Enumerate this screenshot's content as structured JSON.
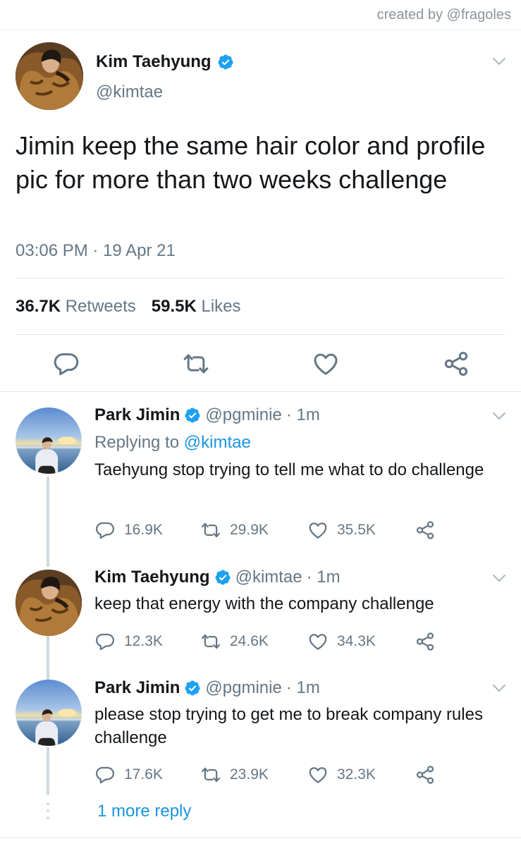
{
  "credit": "created by @fragoles",
  "colors": {
    "accent": "#1da1f2",
    "link": "#1b95e0",
    "muted": "#657786",
    "verified": "#1da1f2"
  },
  "main_tweet": {
    "name": "Kim Taehyung",
    "handle": "@kimtae",
    "verified": true,
    "text": "Jimin keep the same hair color and profile pic for more than two weeks challenge",
    "time": "03:06 PM · 19 Apr 21",
    "retweets_count": "36.7K",
    "retweets_label": "Retweets",
    "likes_count": "59.5K",
    "likes_label": "Likes",
    "actions": [
      "reply-icon",
      "retweet-icon",
      "like-icon",
      "share-icon"
    ]
  },
  "replies": [
    {
      "name": "Park Jimin",
      "handle": "@pgminie",
      "time": "· 1m",
      "verified": true,
      "replying_prefix": "Replying to",
      "replying_to": "@kimtae",
      "text": "Taehyung stop trying to tell me what to do challenge",
      "replies": "16.9K",
      "retweets": "29.9K",
      "likes": "35.5K"
    },
    {
      "name": "Kim Taehyung",
      "handle": "@kimtae",
      "time": "· 1m",
      "verified": true,
      "text": "keep that energy with the company challenge",
      "replies": "12.3K",
      "retweets": "24.6K",
      "likes": "34.3K"
    },
    {
      "name": "Park Jimin",
      "handle": "@pgminie",
      "time": "· 1m",
      "verified": true,
      "text": "please stop trying to get me to break company rules challenge",
      "replies": "17.6K",
      "retweets": "23.9K",
      "likes": "32.3K"
    }
  ],
  "more_replies": "1 more reply"
}
